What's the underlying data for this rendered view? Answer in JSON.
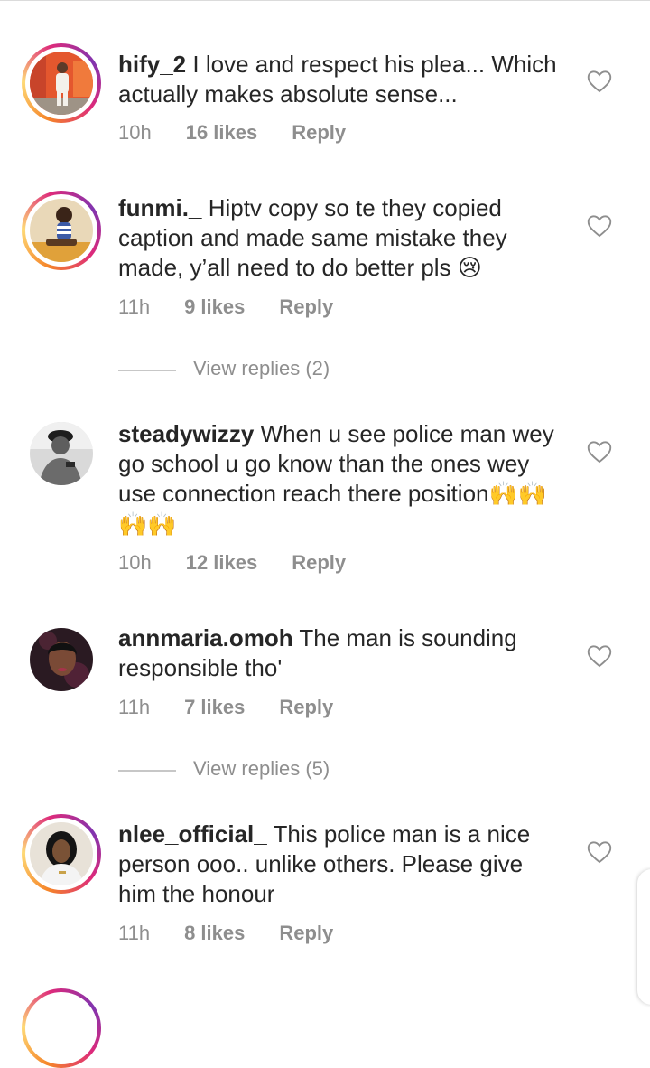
{
  "comments": [
    {
      "username": "hify_2",
      "text": "I love and respect his plea... Which actually makes absolute sense...",
      "time": "10h",
      "likes": "16 likes",
      "reply": "Reply"
    },
    {
      "username": "funmi._",
      "text": "Hiptv copy so te they copied caption and made same mistake they made, y’all need to do better pls",
      "emoji": "😢",
      "time": "11h",
      "likes": "9 likes",
      "reply": "Reply",
      "view_replies": "View replies (2)"
    },
    {
      "username": "steadywizzy",
      "text": "When u see police man wey go school u go know than the ones wey use connection reach there position",
      "emoji": "🙌🙌🙌🙌",
      "time": "10h",
      "likes": "12 likes",
      "reply": "Reply"
    },
    {
      "username": "annmaria.omoh",
      "text": "The man is sounding responsible tho'",
      "time": "11h",
      "likes": "7 likes",
      "reply": "Reply",
      "view_replies": "View replies (5)"
    },
    {
      "username": "nlee_official_",
      "text": "This police man is a nice person ooo.. unlike others. Please give him the honour",
      "time": "11h",
      "likes": "8 likes",
      "reply": "Reply"
    }
  ],
  "icons": {
    "heart": "heart-outline-icon"
  },
  "colors": {
    "meta_gray": "#8e8e8e",
    "text": "#262626",
    "ring_start": "#f58529",
    "ring_end": "#dd2a7b"
  }
}
